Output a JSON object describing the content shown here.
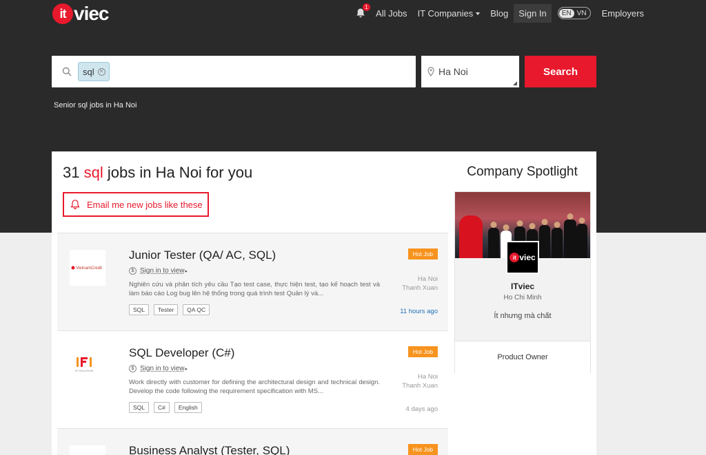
{
  "header": {
    "logo_it": "it",
    "logo_viec": "viec",
    "notification_count": "1",
    "nav": {
      "all_jobs": "All Jobs",
      "it_companies": "IT Companies",
      "blog": "Blog",
      "sign_in": "Sign In",
      "lang_en": "EN",
      "lang_vn": "VN",
      "employers": "Employers"
    }
  },
  "search": {
    "keyword_chip": "sql",
    "location": "Ha Noi",
    "button": "Search"
  },
  "breadcrumb": "Senior sql jobs in Ha Noi",
  "results": {
    "count": "31",
    "keyword": "sql",
    "suffix": "jobs in Ha Noi for you",
    "email_button": "Email me new jobs like these"
  },
  "jobs": [
    {
      "title": "Junior Tester (QA/ AC, SQL)",
      "salary_link": "Sign in to view",
      "description": "Nghiên cứu và phân tích yêu cầu Tạo test case, thực hiện test, tạo kế hoạch test và làm báo cáo Log bug lên hệ thống trong quá trình test Quản lý và...",
      "tags": [
        "SQL",
        "Tester",
        "QA QC"
      ],
      "badge": "Hot Job",
      "city": "Ha Noi",
      "district": "Thanh Xuan",
      "posted": "11 hours ago",
      "company_logo": "VietnamCredit"
    },
    {
      "title": "SQL Developer (C#)",
      "salary_link": "Sign in to view",
      "description": "Work directly with customer for defining the architectural design and technical design. Develop the code following the requirement specification with MS...",
      "tags": [
        "SQL",
        "C#",
        "English"
      ],
      "badge": "Hot Job",
      "city": "Ha Noi",
      "district": "Thanh Xuan",
      "posted": "4 days ago",
      "company_logo": "IFI SOLUTION"
    },
    {
      "title": "Business Analyst (Tester, SQL)",
      "badge": "Hot Job"
    }
  ],
  "spotlight": {
    "heading": "Company Spotlight",
    "name": "ITviec",
    "city": "Ho Chi Minh",
    "slogan": "Ít nhưng mà chất",
    "job": "Product Owner"
  },
  "colors": {
    "brand_red": "#e8192c",
    "hot_orange": "#f7931e",
    "dark_band": "#2a2a2b"
  }
}
